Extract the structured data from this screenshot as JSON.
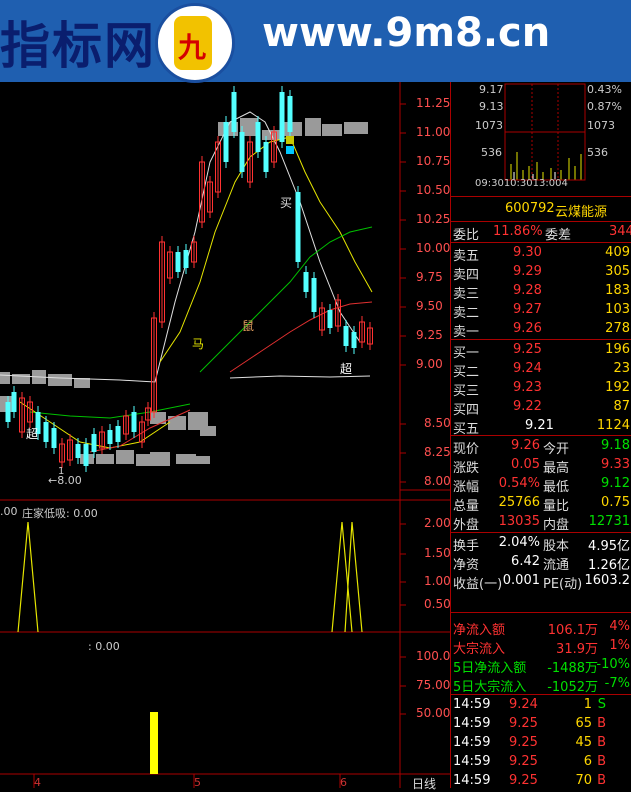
{
  "banner": {
    "brand": "指标网",
    "url": "www.9m8.cn",
    "logo_char": "九"
  },
  "stock": {
    "code": "600792",
    "name": "云煤能源"
  },
  "mini_chart": {
    "price_hi": "9.17",
    "price_mid": "9.13",
    "pct_hi": "0.43%",
    "pct_mid": "0.87%",
    "vol1": "1073",
    "vol2": "536",
    "vol1r": "1073",
    "vol2r": "536",
    "times": "09:3010:3013:004"
  },
  "order_book": {
    "wei_bi_label": "委比",
    "wei_bi": "11.86%",
    "wei_cha_label": "委差",
    "wei_cha": "344",
    "asks": [
      {
        "label": "卖五",
        "price": "9.30",
        "vol": "409"
      },
      {
        "label": "卖四",
        "price": "9.29",
        "vol": "305"
      },
      {
        "label": "卖三",
        "price": "9.28",
        "vol": "183"
      },
      {
        "label": "卖二",
        "price": "9.27",
        "vol": "103"
      },
      {
        "label": "卖一",
        "price": "9.26",
        "vol": "278"
      }
    ],
    "bids": [
      {
        "label": "买一",
        "price": "9.25",
        "vol": "196"
      },
      {
        "label": "买二",
        "price": "9.24",
        "vol": "23"
      },
      {
        "label": "买三",
        "price": "9.23",
        "vol": "192"
      },
      {
        "label": "买四",
        "price": "9.22",
        "vol": "87"
      },
      {
        "label": "买五",
        "price": "9.21",
        "vol": "1124"
      }
    ]
  },
  "quote": {
    "xj_l": "现价",
    "xj": "9.26",
    "jk_l": "今开",
    "jk": "9.18",
    "zd_l": "涨跌",
    "zd": "0.05",
    "zg_l": "最高",
    "zg": "9.33",
    "zf_l": "涨幅",
    "zf": "0.54%",
    "zdi_l": "最低",
    "zdi": "9.12",
    "zl_l": "总量",
    "zl": "25766",
    "lb_l": "量比",
    "lb": "0.75",
    "wp_l": "外盘",
    "wp": "13035",
    "np_l": "内盘",
    "np": "12731",
    "hs_l": "换手",
    "hs": "2.04%",
    "gb_l": "股本",
    "gb": "4.95亿",
    "jz_l": "净资",
    "jz": "6.42",
    "lt_l": "流通",
    "lt": "1.26亿",
    "sy_l": "收益(一)",
    "sy": "0.001",
    "pe_l": "PE(动)",
    "pe": "1603.2"
  },
  "flows": [
    {
      "label": "净流入额",
      "val": "106.1万",
      "pct": "4%"
    },
    {
      "label": "大宗流入",
      "val": "31.9万",
      "pct": "1%"
    },
    {
      "label": "5日净流入额",
      "val": "-1488万",
      "pct": "-10%"
    },
    {
      "label": "5日大宗流入",
      "val": "-1052万",
      "pct": "-7%"
    }
  ],
  "ticks": [
    {
      "t": "14:59",
      "p": "9.24",
      "v": "1",
      "s": "S"
    },
    {
      "t": "14:59",
      "p": "9.25",
      "v": "65",
      "s": "B"
    },
    {
      "t": "14:59",
      "p": "9.25",
      "v": "45",
      "s": "B"
    },
    {
      "t": "14:59",
      "p": "9.25",
      "v": "6",
      "s": "B"
    },
    {
      "t": "14:59",
      "p": "9.25",
      "v": "70",
      "s": "B"
    }
  ],
  "main_chart": {
    "axis_top": [
      "11.25",
      "11.00",
      "10.75",
      "10.50",
      "10.25",
      "10.00",
      "9.75",
      "9.50",
      "9.25",
      "9.00"
    ],
    "axis_low": [
      "8.50",
      "8.25",
      "8.00"
    ],
    "labels": {
      "buy": "买",
      "ma": "马",
      "shu": "鼠",
      "chao": "超",
      "chao2": "超",
      "low_mark": "←8.00",
      "one": "1"
    }
  },
  "indicator1": {
    "title": "庄家低吸: 0.00",
    "prefix": ".00",
    "axis": [
      "2.00",
      "1.50",
      "1.00",
      "0.50"
    ]
  },
  "indicator2": {
    "title": ": 0.00",
    "axis": [
      "100.0",
      "75.00",
      "50.00"
    ]
  },
  "bottom": {
    "d4": "4",
    "d5": "5",
    "d6": "6",
    "period": "日线"
  }
}
